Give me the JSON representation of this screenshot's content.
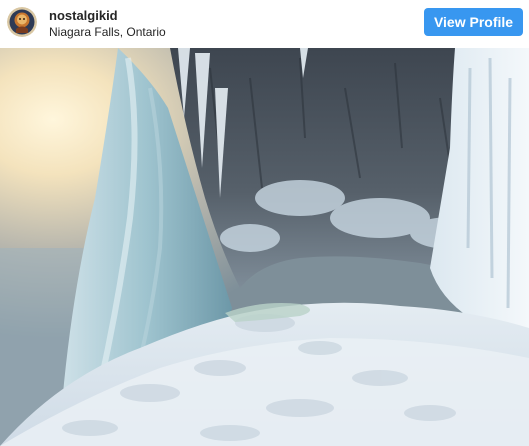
{
  "post": {
    "username": "nostalgikid",
    "location": "Niagara Falls, Ontario",
    "view_profile_label": "View Profile"
  },
  "avatar": {
    "icon": "profile-avatar"
  },
  "photo": {
    "subject": "frozen-waterfall"
  },
  "colors": {
    "button_bg": "#3897f0",
    "button_text": "#ffffff",
    "text": "#262626"
  }
}
